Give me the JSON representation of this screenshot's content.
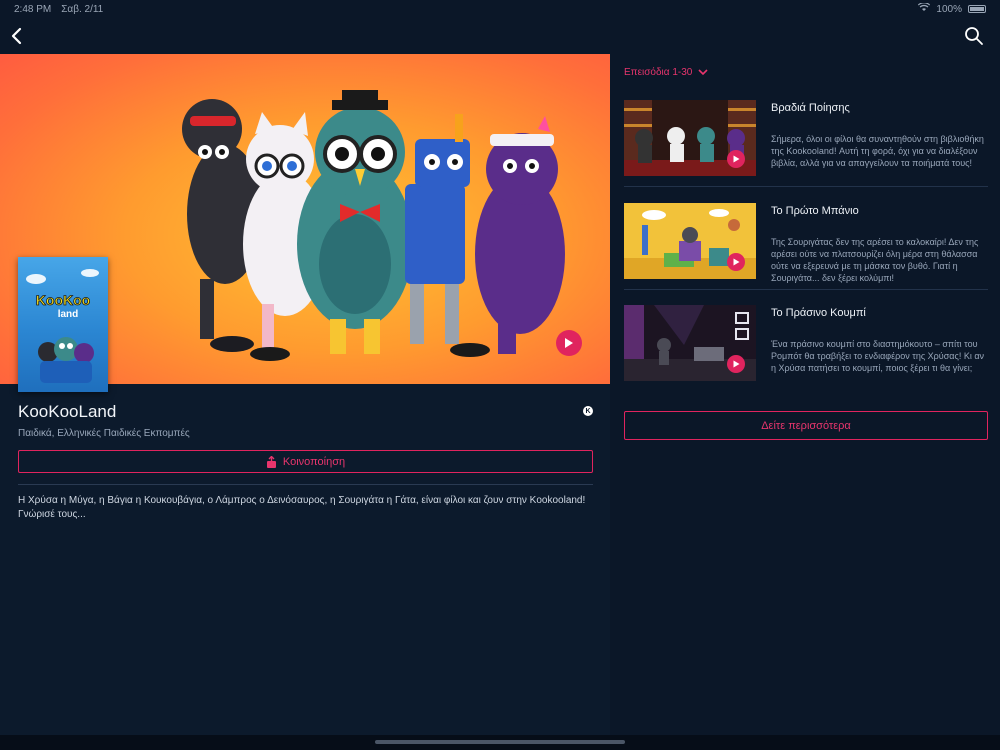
{
  "status_bar": {
    "time": "2:48 PM",
    "date": "Σαβ. 2/11",
    "battery": "100%"
  },
  "show": {
    "title": "KooKooLand",
    "genre": "Παιδικά, Ελληνικές Παιδικές Εκπομπές",
    "rating_badge": "K",
    "share_label": "Κοινοποίηση",
    "description": "Η Χρύσα η Μύγα, η Βάγια η Κουκουβάγια, ο Λάμπρος ο Δεινόσαυρος, η Σουριγάτα η Γάτα, είναι φίλοι και ζουν στην Kookooland! Γνώρισέ τους...",
    "poster_logo_line1": "KooKoo",
    "poster_logo_line2": "land"
  },
  "episodes": {
    "dropdown_label": "Επεισόδια 1-30",
    "items": [
      {
        "title": "Βραδιά Ποίησης",
        "description": "Σήμερα, όλοι οι φίλοι θα συναντηθούν στη βιβλιοθήκη της Kookooland! Αυτή τη φορά, όχι για να διαλέξουν βιβλία, αλλά για να απαγγείλουν τα ποιήματά τους!"
      },
      {
        "title": "Το Πρώτο Μπάνιο",
        "description": "Της Σουριγάτας δεν της αρέσει το καλοκαίρι! Δεν της αρέσει ούτε να πλατσουρίζει όλη μέρα στη θάλασσα ούτε να εξερευνά με τη μάσκα τον βυθό. Γιατί η Σουριγάτα... δεν ξέρει κολύμπι!"
      },
      {
        "title": "Το Πράσινο Κουμπί",
        "description": "Ένα πράσινο κουμπί στο διαστημόκουτο – σπίτι του Ρομπότ θα τραβήξει το ενδιαφέρον της Χρύσας! Κι αν η Χρύσα πατήσει το κουμπί, ποιος ξέρει τι θα γίνει;"
      }
    ],
    "more_label": "Δείτε περισσότερα"
  },
  "colors": {
    "accent": "#e0245e",
    "background": "#0b1728"
  },
  "icons": {
    "back": "chevron-left-icon",
    "search": "search-icon",
    "play": "play-icon",
    "share": "share-icon",
    "dropdown": "chevron-down-icon"
  }
}
